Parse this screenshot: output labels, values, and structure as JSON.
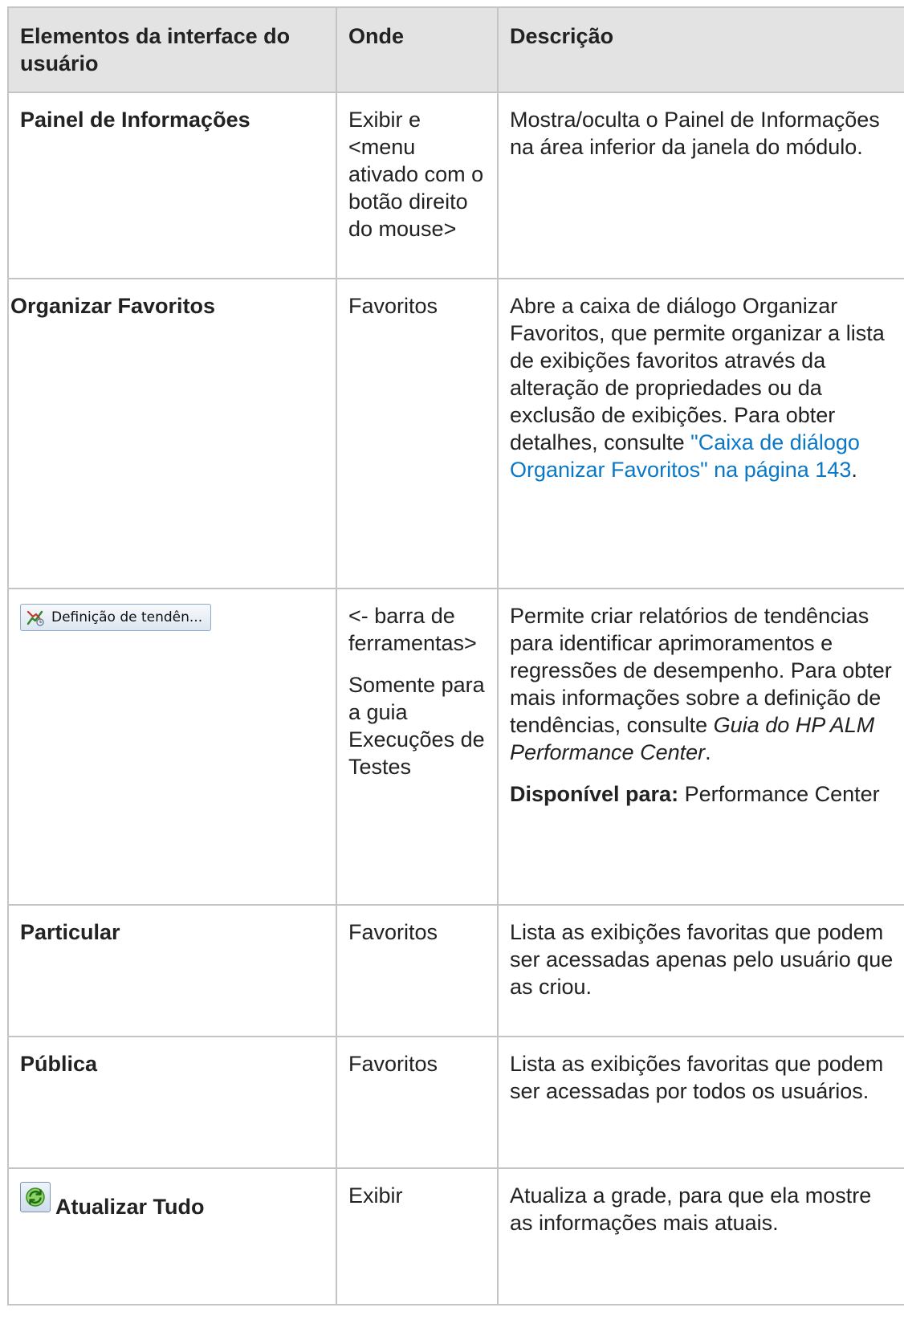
{
  "headers": [
    "Elementos da interface do usuário",
    "Onde",
    "Descrição"
  ],
  "rows": [
    {
      "name": "Painel de Informações",
      "where": [
        "Exibir e <menu ativado com o botão direito do mouse>"
      ],
      "description": "Mostra/oculta o Painel de Informações na área inferior da janela do módulo."
    },
    {
      "name": "Organizar Favoritos",
      "where": [
        "Favoritos"
      ],
      "description_before_link": "Abre a caixa de diálogo Organizar Favoritos, que permite organizar a lista de exibições favoritos através da alteração de propriedades ou da exclusão de exibições. Para obter detalhes, consulte ",
      "link": "\"Caixa de diálogo Organizar Favoritos\" na página 143",
      "description_after_link": "."
    },
    {
      "button_label": "Definição de tendên...",
      "button_icon": "trend-definition-icon",
      "where": [
        "<- barra de ferramentas>",
        "Somente para a guia Execuções de Testes"
      ],
      "description_before_italic": "Permite criar relatórios de tendências para identificar aprimoramentos e regressões de desempenho. Para obter mais informações sobre a definição de tendências, consulte ",
      "italic": "Guia do HP ALM Performance Center",
      "description_after_italic": ".",
      "available_label": "Disponível para:",
      "available_value": " Performance Center"
    },
    {
      "name": "Particular",
      "where": [
        "Favoritos"
      ],
      "description": "Lista as exibições favoritas que podem ser acessadas apenas pelo usuário que as criou."
    },
    {
      "name": "Pública",
      "where": [
        "Favoritos"
      ],
      "description": "Lista as exibições favoritas que podem ser acessadas por todos os usuários."
    },
    {
      "name": "Atualizar Tudo",
      "icon": "refresh-icon",
      "where": [
        "Exibir"
      ],
      "description": "Atualiza a grade, para que ela mostre as informações mais atuais."
    }
  ],
  "colors": {
    "header_bg": "#e3e3e3",
    "border": "#c4c4c4",
    "link": "#0a78c6"
  }
}
